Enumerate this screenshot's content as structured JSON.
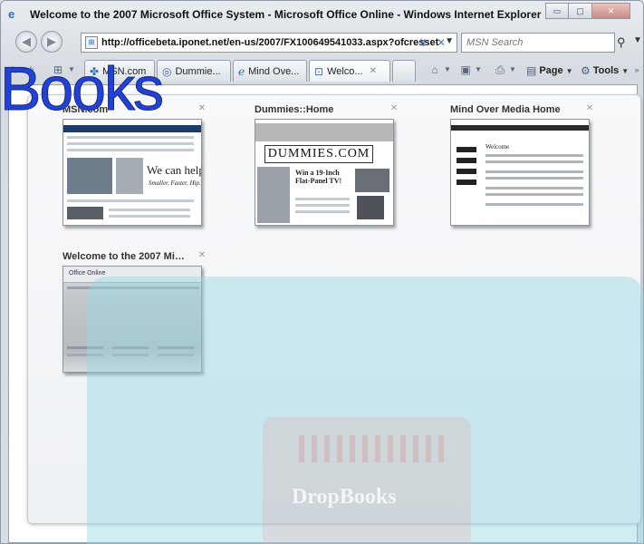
{
  "window": {
    "title": "Welcome to the 2007 Microsoft Office System - Microsoft Office Online - Windows Internet Explorer",
    "controls": {
      "minimize": "▭",
      "maximize": "▢",
      "close": "✕"
    }
  },
  "nav": {
    "back_icon": "back-arrow-icon",
    "forward_icon": "forward-arrow-icon",
    "address": "http://officebeta.iponet.net/en-us/2007/FX100649541033.aspx?ofcresset",
    "search_placeholder": "MSN Search"
  },
  "tabs": [
    {
      "label": "MSN.com",
      "icon": "msn-butterfly-icon"
    },
    {
      "label": "Dummie...",
      "icon": "dummies-logo-icon"
    },
    {
      "label": "Mind Ove...",
      "icon": "ie-page-icon"
    },
    {
      "label": "Welco...",
      "icon": "office-page-icon",
      "active": true,
      "close": "✕"
    }
  ],
  "commands": {
    "page": "Page",
    "tools": "Tools"
  },
  "quick_tabs": [
    {
      "title": "MSN.com",
      "close": "✕"
    },
    {
      "title": "Dummies::Home",
      "close": "✕"
    },
    {
      "title": "Mind Over Media Home",
      "close": "✕"
    },
    {
      "title": "Welcome to the 2007 Micr...",
      "close": "✕"
    }
  ],
  "thumbnails": {
    "msn_promo": "We can help",
    "msn_promo_sub": "Smaller. Faster. Hip.",
    "dummies_logo": "DUMMIES.COM",
    "dummies_feature": "Win a 19-Inch Flat-Panel TV!",
    "mom_welcome": "Welcome",
    "office_logo": "Office Online"
  },
  "overlay": {
    "text": "Books"
  },
  "watermark": {
    "text": "DropBooks"
  }
}
